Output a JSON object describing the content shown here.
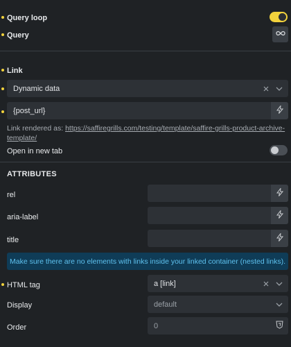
{
  "query_loop": {
    "label": "Query loop",
    "enabled": true
  },
  "query": {
    "label": "Query",
    "icon": "infinity-icon"
  },
  "link": {
    "label": "Link",
    "type_value": "Dynamic data",
    "url_value": "{post_url}",
    "rendered_prefix": "Link rendered as:",
    "rendered_url": "https://saffiregrills.com/testing/template/saffire-grills-product-archive-template/"
  },
  "open_new_tab": {
    "label": "Open in new tab",
    "enabled": false
  },
  "attributes": {
    "heading": "ATTRIBUTES",
    "rel": {
      "label": "rel",
      "value": ""
    },
    "aria_label": {
      "label": "aria-label",
      "value": ""
    },
    "title": {
      "label": "title",
      "value": ""
    }
  },
  "notice": "Make sure there are no elements with links inside your linked container (nested links).",
  "html_tag": {
    "label": "HTML tag",
    "value": "a [link]"
  },
  "display": {
    "label": "Display",
    "value": "default"
  },
  "order": {
    "label": "Order",
    "value": "0"
  },
  "colors": {
    "accent": "#f2d23c",
    "background": "#1f2225",
    "field": "#2d3136",
    "info_bg": "#0f3c57",
    "info_text": "#5fc2ef"
  }
}
